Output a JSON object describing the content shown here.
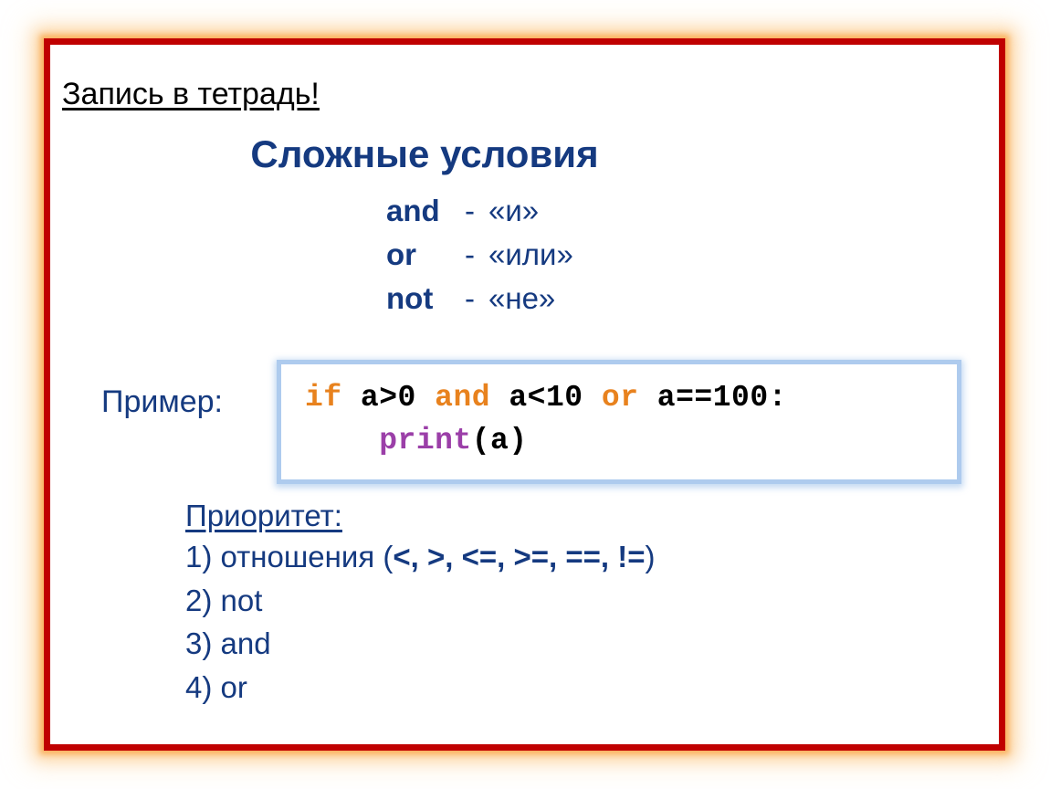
{
  "slide": {
    "notebook_heading": "Запись в тетрадь!",
    "title": "Сложные условия",
    "example_label": "Пример:",
    "colors": {
      "navy": "#153a80",
      "border_red": "#c00000",
      "glow_orange": "#fab05c",
      "code_border_blue": "#aecbee",
      "keyword_orange": "#e8821e",
      "function_purple": "#9b3fa8",
      "text_black": "#000000",
      "background": "#ffffff"
    }
  },
  "operators": [
    {
      "keyword": "and",
      "sep": "-",
      "meaning": "«и»"
    },
    {
      "keyword": "or",
      "sep": "-",
      "meaning": "«или»"
    },
    {
      "keyword": "not",
      "sep": "-",
      "meaning": "«не»"
    }
  ],
  "code": {
    "line1": {
      "kw_if": "if",
      "cond1": " a>0 ",
      "kw_and": "and",
      "cond2": " a<10 ",
      "kw_or": "or",
      "cond3": " a==100:"
    },
    "line2": {
      "indent": "    ",
      "fn_print": "print",
      "args": "(a)"
    },
    "plain_text": "if a>0 and a<10 or a==100:\n    print(a)"
  },
  "priority": {
    "title": "Приоритет:",
    "items": [
      {
        "num": "1)",
        "text": "отношения (",
        "ops": "<, >, <=, >=, ==, !=",
        "tail": ")"
      },
      {
        "num": "2)",
        "text": "not",
        "ops": "",
        "tail": ""
      },
      {
        "num": "3)",
        "text": "and",
        "ops": "",
        "tail": ""
      },
      {
        "num": "4)",
        "text": "or",
        "ops": "",
        "tail": ""
      }
    ]
  }
}
